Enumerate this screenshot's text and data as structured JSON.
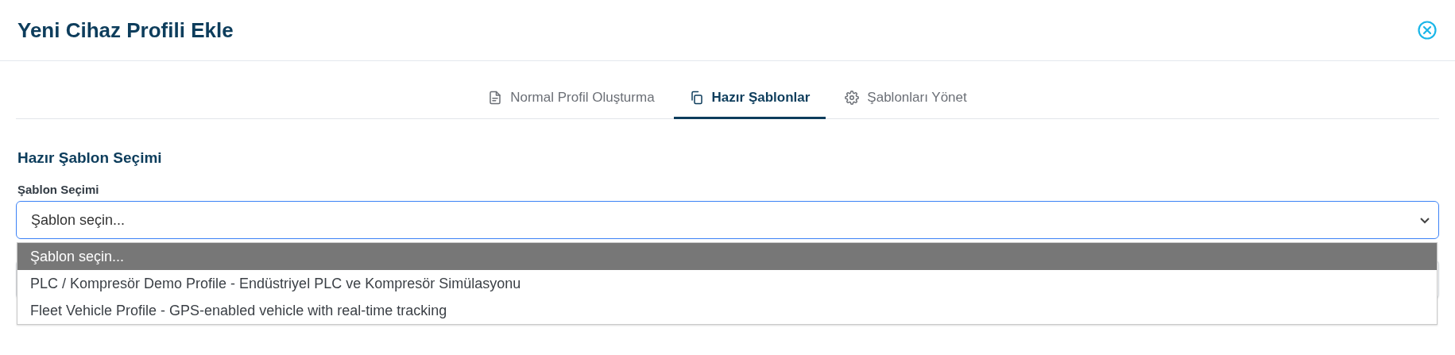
{
  "header": {
    "title": "Yeni Cihaz Profili Ekle"
  },
  "tabs": [
    {
      "label": "Normal Profil Oluşturma",
      "selected": false
    },
    {
      "label": "Hazır Şablonlar",
      "selected": true
    },
    {
      "label": "Şablonları Yönet",
      "selected": false
    }
  ],
  "section": {
    "title": "Hazır Şablon Seçimi",
    "field_label": "Şablon Seçimi",
    "select_value": "Şablon seçin...",
    "expanded": true,
    "options": [
      {
        "label": "Şablon seçin...",
        "selected": true
      },
      {
        "label": "PLC / Kompresör Demo Profile - Endüstriyel PLC ve Kompresör Simülasyonu",
        "selected": false
      },
      {
        "label": "Fleet Vehicle Profile - GPS-enabled vehicle with real-time tracking",
        "selected": false
      }
    ]
  }
}
